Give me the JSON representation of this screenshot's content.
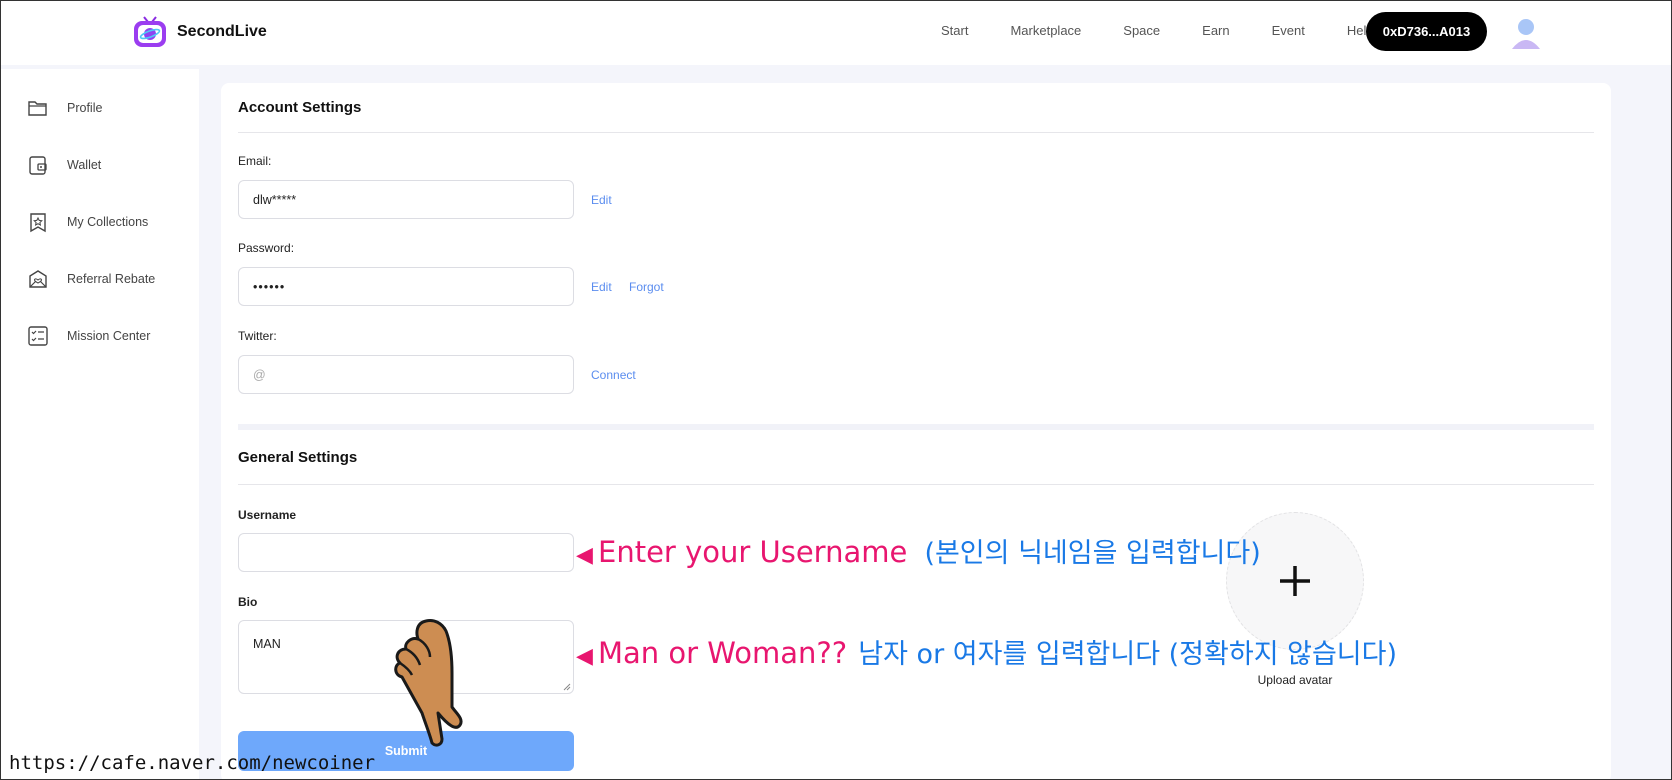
{
  "app": {
    "name": "SecondLive"
  },
  "nav": [
    "Start",
    "Marketplace",
    "Space",
    "Earn",
    "Event",
    "Help"
  ],
  "wallet": {
    "address": "0xD736...A013"
  },
  "sidebar": {
    "items": [
      {
        "label": "Profile",
        "icon": "folder-icon"
      },
      {
        "label": "Wallet",
        "icon": "wallet-icon"
      },
      {
        "label": "My Collections",
        "icon": "bookmark-star-icon"
      },
      {
        "label": "Referral Rebate",
        "icon": "envelope-heart-icon"
      },
      {
        "label": "Mission Center",
        "icon": "checklist-icon"
      }
    ]
  },
  "account": {
    "title": "Account Settings",
    "email_label": "Email:",
    "email_value": "dlw*****",
    "email_edit": "Edit",
    "password_label": "Password:",
    "password_value": "••••••",
    "password_edit": "Edit",
    "password_forgot": "Forgot",
    "twitter_label": "Twitter:",
    "twitter_placeholder": "@",
    "twitter_connect": "Connect"
  },
  "general": {
    "title": "General Settings",
    "username_label": "Username",
    "username_value": "",
    "bio_label": "Bio",
    "bio_value": "MAN",
    "submit_label": "Submit",
    "upload_label": "Upload avatar"
  },
  "annotations": {
    "username_pointer": "◀",
    "username_en": "Enter your Username",
    "username_ko": "(본인의 닉네임을 입력합니다)",
    "bio_pointer": "◀",
    "bio_en": "Man or Woman??",
    "bio_ko": "남자 or 여자를 입력합니다 (정확하지 않습니다)"
  },
  "watermark": "https://cafe.naver.com/newcoiner",
  "colors": {
    "accent": "#5b8def",
    "submit": "#6ea8fb",
    "annotation_pink": "#e8166f",
    "annotation_blue": "#1979e6"
  }
}
